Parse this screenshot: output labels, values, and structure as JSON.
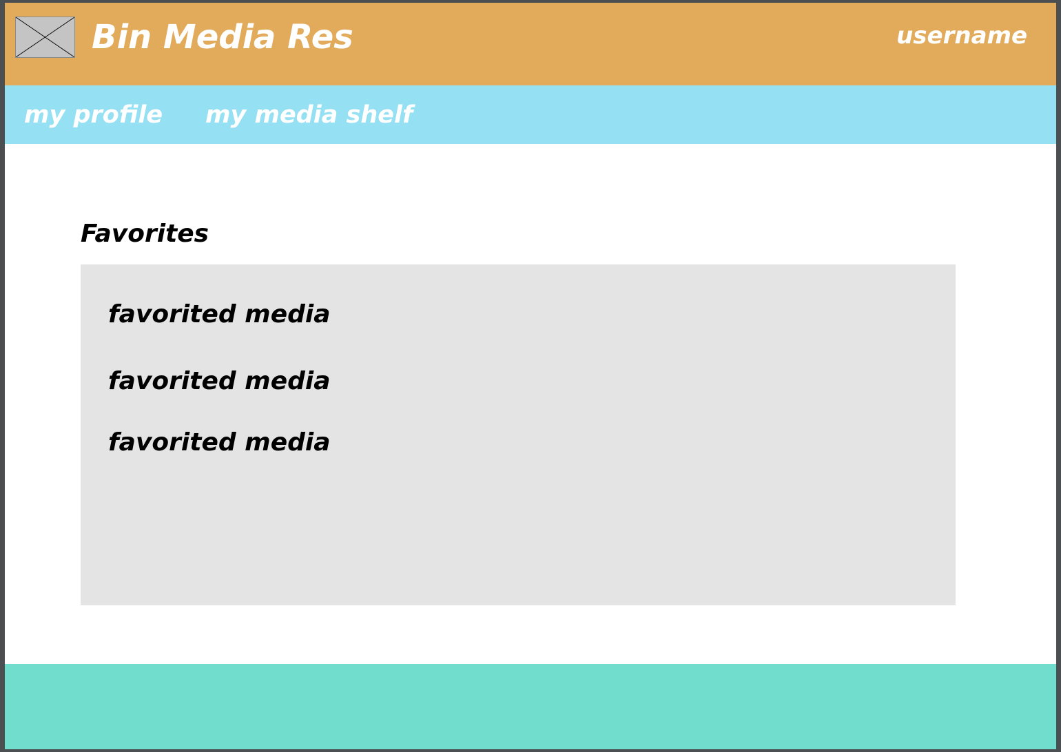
{
  "header": {
    "logo_icon": "image-placeholder-icon",
    "brand_title": "Bin Media Res",
    "username": "username",
    "background_color": "#e2ab5c"
  },
  "nav": {
    "items": [
      {
        "label": "my profile"
      },
      {
        "label": "my media shelf"
      }
    ],
    "background_color": "#96e0f4"
  },
  "main": {
    "section_title": "Favorites",
    "favorites": [
      {
        "label": "favorited media"
      },
      {
        "label": "favorited media"
      },
      {
        "label": "favorited media"
      }
    ],
    "panel_color": "#e4e4e4"
  },
  "footer": {
    "background_color": "#70ddcd"
  }
}
